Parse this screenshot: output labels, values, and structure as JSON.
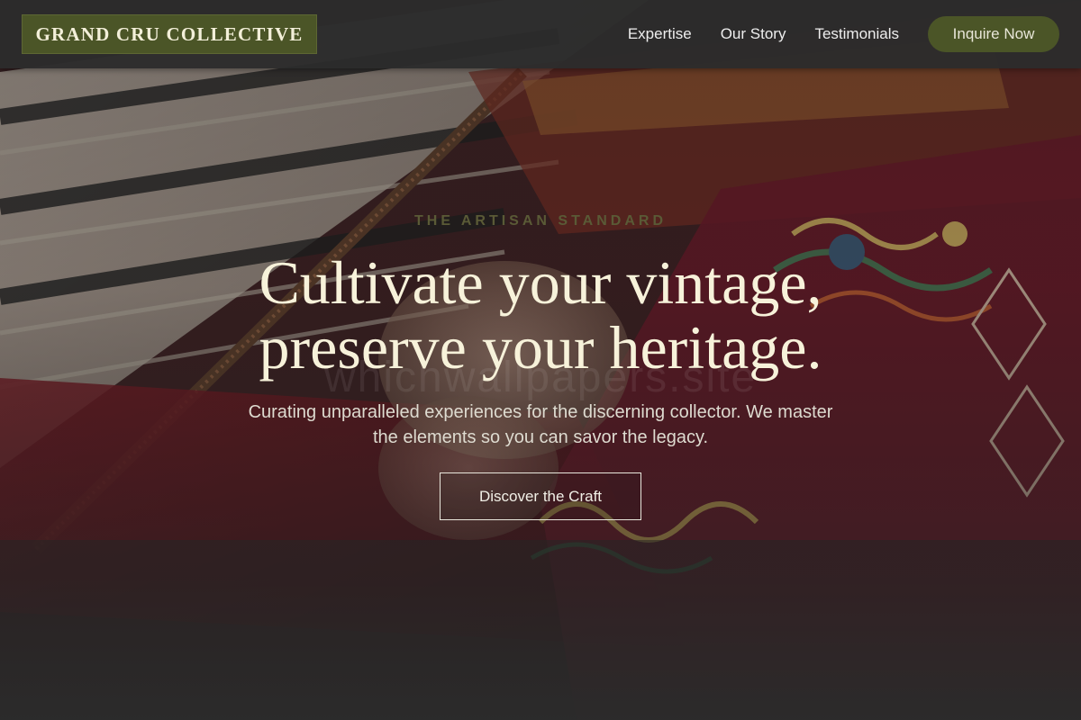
{
  "brand": {
    "name": "GRAND CRU COLLECTIVE"
  },
  "nav": {
    "links": [
      {
        "label": "Expertise"
      },
      {
        "label": "Our Story"
      },
      {
        "label": "Testimonials"
      }
    ],
    "cta_label": "Inquire Now"
  },
  "hero": {
    "eyebrow": "THE ARTISAN STANDARD",
    "headline_line1": "Cultivate your vintage,",
    "headline_line2": "preserve your heritage.",
    "watermark": "whichwallpapers.site",
    "subtitle": "Curating unparalleled experiences for the discerning collector. We master the elements so you can savor the legacy.",
    "button_label": "Discover the Craft"
  },
  "colors": {
    "accent_olive": "#4b5527",
    "header_bg": "#2c2c2c",
    "headline_cream": "#f7f2da",
    "eyebrow_olive": "#5a5a36"
  }
}
